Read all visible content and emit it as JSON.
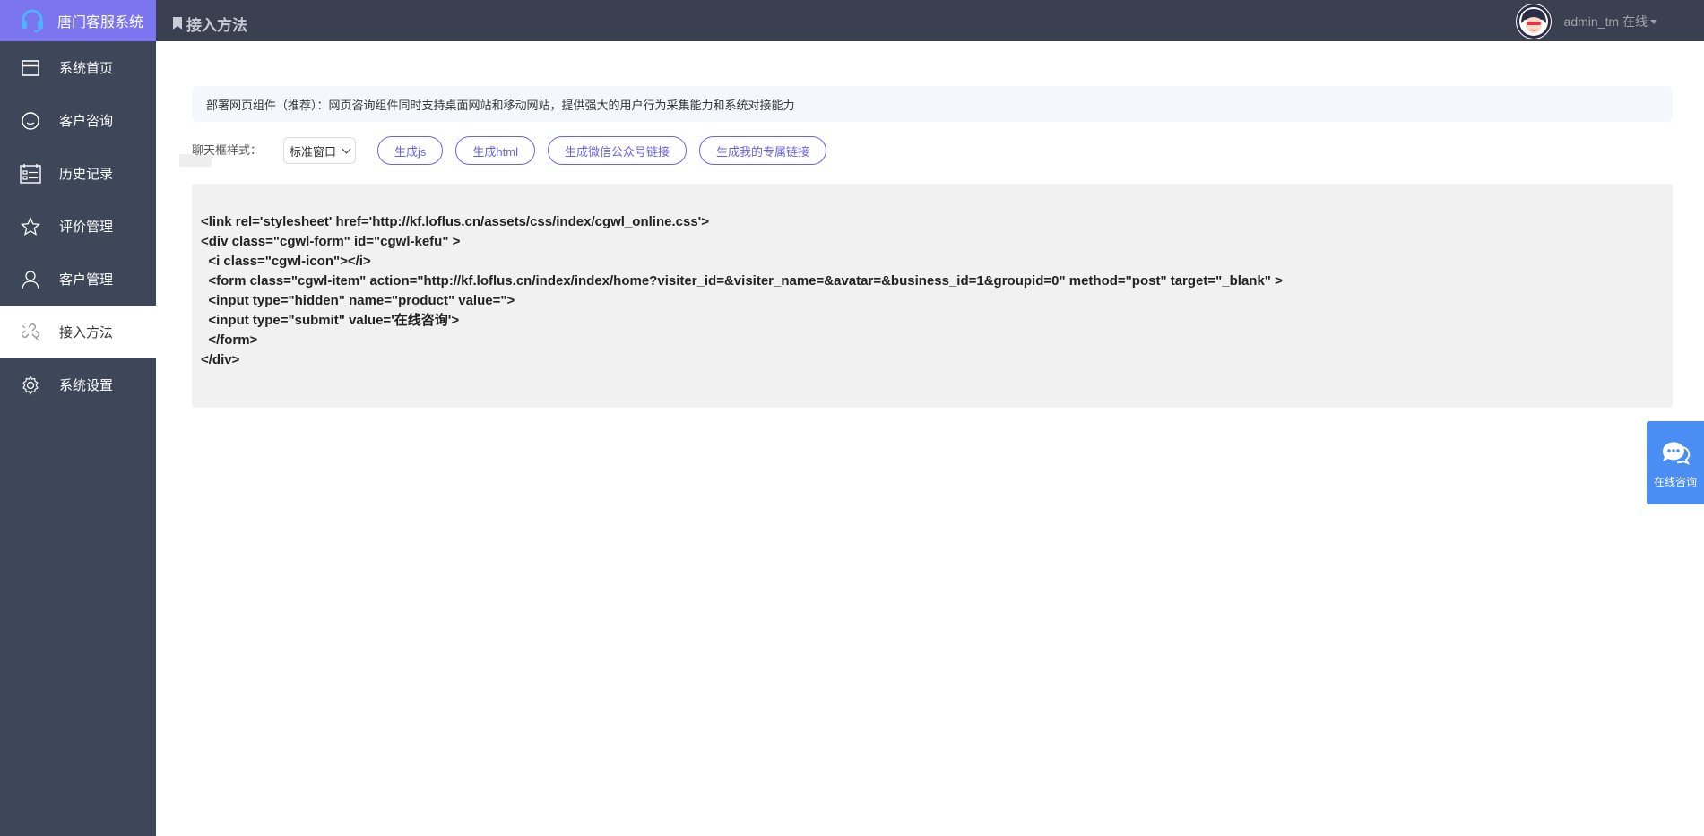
{
  "app": {
    "brand": "唐门客服系统"
  },
  "header": {
    "title": "接入方法",
    "user": {
      "name": "admin_tm",
      "status": "在线"
    }
  },
  "sidebar": {
    "items": [
      {
        "label": "系统首页",
        "icon": "window-icon"
      },
      {
        "label": "客户咨询",
        "icon": "smile-icon"
      },
      {
        "label": "历史记录",
        "icon": "list-icon"
      },
      {
        "label": "评价管理",
        "icon": "star-icon"
      },
      {
        "label": "客户管理",
        "icon": "user-icon"
      },
      {
        "label": "接入方法",
        "icon": "link-icon",
        "active": true
      },
      {
        "label": "系统设置",
        "icon": "gear-icon"
      }
    ]
  },
  "main": {
    "notice": "部署网页组件（推荐）：网页咨询组件同时支持桌面网站和移动网站，提供强大的用户行为采集能力和系统对接能力",
    "style_label": "聊天框样式：",
    "style_select": "标准窗口",
    "buttons": {
      "gen_js": "生成js",
      "gen_html": "生成html",
      "gen_wechat": "生成微信公众号链接",
      "gen_exclusive": "生成我的专属链接"
    },
    "code_lines": [
      "<link rel='stylesheet' href='http://kf.loflus.cn/assets/css/index/cgwl_online.css'>",
      "<div class=\"cgwl-form\" id=\"cgwl-kefu\" >",
      "  <i class=\"cgwl-icon\"></i>",
      "  <form class=\"cgwl-item\" action=\"http://kf.loflus.cn/index/index/home?visiter_id=&visiter_name=&avatar=&business_id=1&groupid=0\" method=\"post\" target=\"_blank\" >",
      "  <input type=\"hidden\" name=\"product\" value=\">",
      "  <input type=\"submit\" value='在线咨询'>",
      "  </form>",
      "</div>"
    ]
  },
  "float": {
    "consult_label": "在线咨询"
  },
  "colors": {
    "sidebar_bg": "#3e4659",
    "brand_bg": "#7b76f0",
    "topbar_bg": "#3b4050",
    "accent": "#6a63e8",
    "consult_bg": "#4a8ef4"
  }
}
